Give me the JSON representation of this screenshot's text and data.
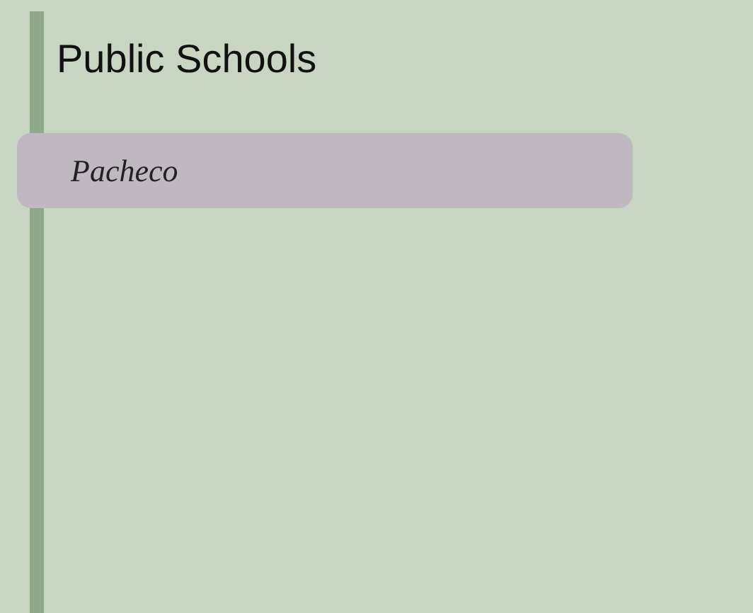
{
  "title": "Public Schools",
  "items": [
    {
      "label": "Pacheco"
    }
  ]
}
